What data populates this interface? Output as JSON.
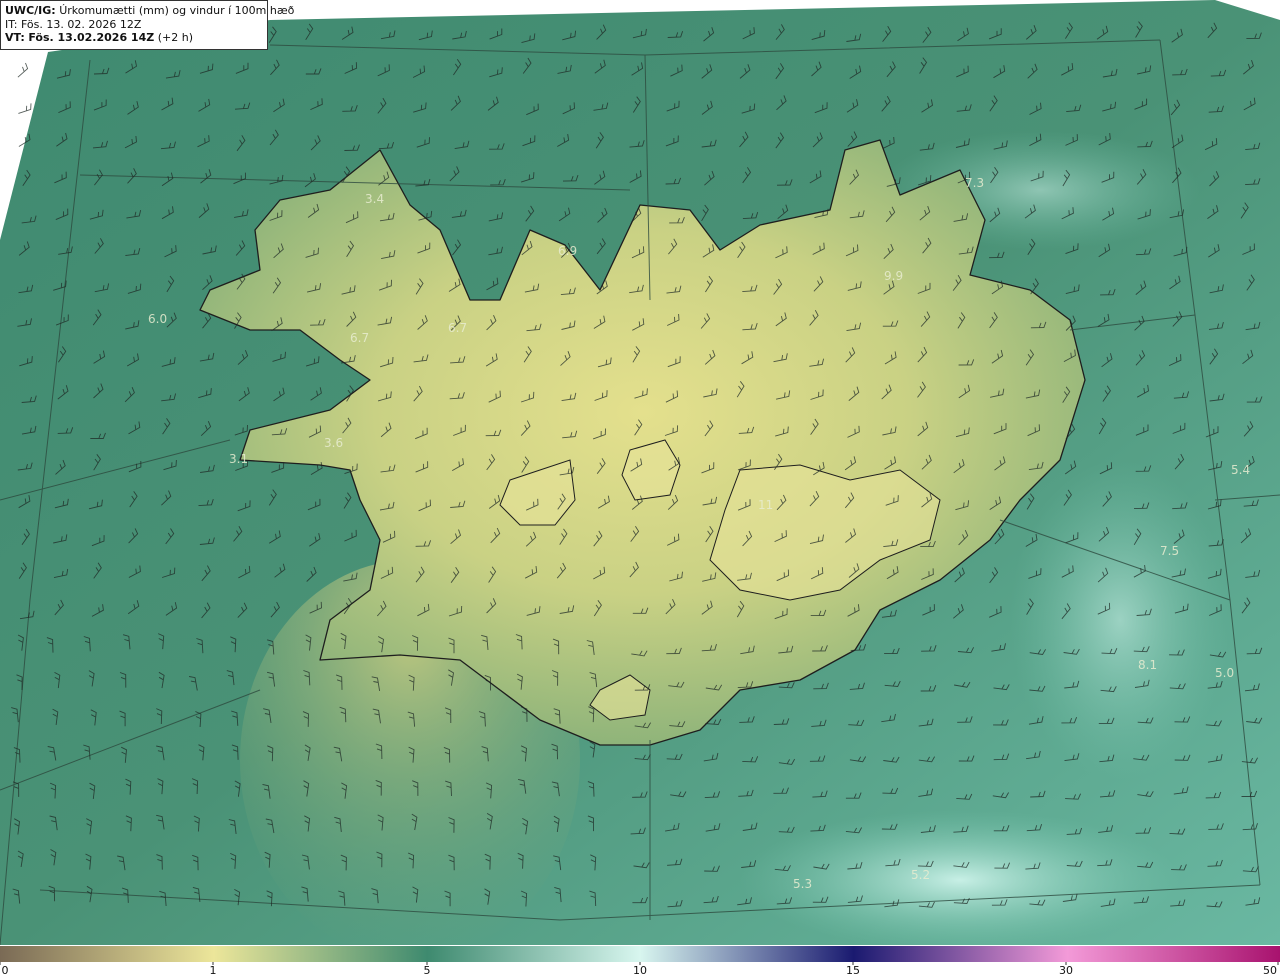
{
  "info": {
    "model": "UWC/IG:",
    "title": "Úrkomumætti (mm) og vindur í 100m hæð",
    "it_label": "IT:",
    "it_value": "Fös. 13. 02. 2026 12Z",
    "vt_label": "VT:",
    "vt_value": "Fös. 13.02.2026 14Z",
    "vt_offset": "(+2 h)"
  },
  "map_labels": [
    "3.4",
    "6.9",
    "7.3",
    "6.0",
    "6.7",
    "6.7",
    "9.9",
    "3.6",
    "3.1",
    "5.4",
    "7.5",
    "11",
    "8.1",
    "5.0",
    "5.3",
    "5.2"
  ],
  "colorbar": {
    "ticks": [
      "0",
      "1",
      "5",
      "10",
      "15",
      "30",
      "50"
    ],
    "tick_values": [
      0,
      1,
      5,
      10,
      15,
      30,
      50
    ],
    "colors": {
      "low": "#7a6a55",
      "one": "#ece69a",
      "five": "#3e8a6f",
      "ten": "#d8f6ef",
      "fifteen": "#1a1a70",
      "thirty": "#f39ad8",
      "fifty": "#a8126e"
    }
  }
}
